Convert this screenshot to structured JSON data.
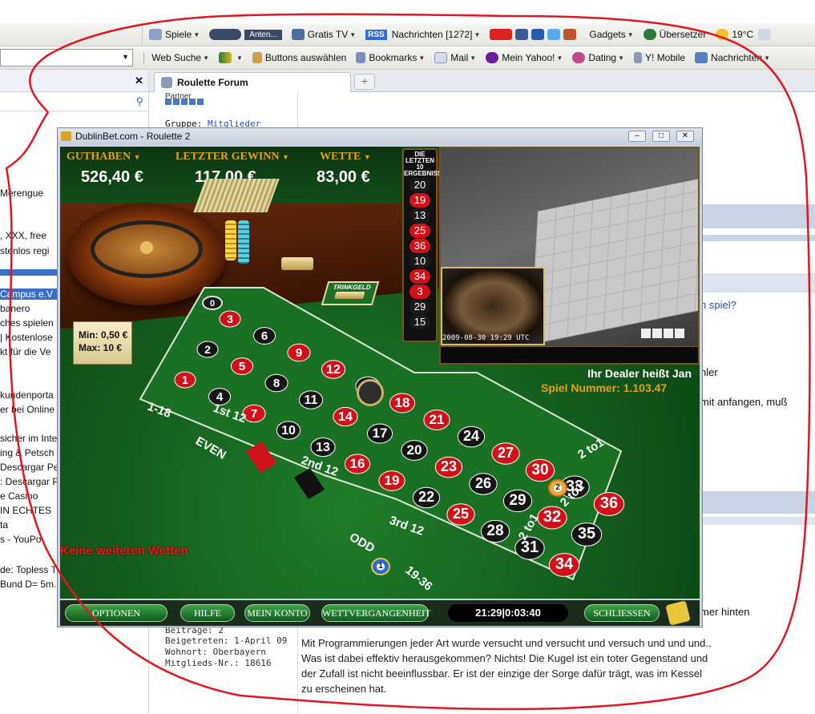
{
  "toolbar1": {
    "items": [
      "Spiele",
      "Anten...",
      "Gratis TV",
      "RSS",
      "Nachrichten [1272]",
      "Gadgets",
      "Übersetzer",
      "19°C"
    ]
  },
  "toolbar2": {
    "items": [
      "Web Suche",
      "Buttons auswählen",
      "Bookmarks",
      "Mail",
      "Mein Yahoo!",
      "Dating",
      "Y! Mobile",
      "Nachrichten"
    ]
  },
  "sidebar": {
    "items": [
      "Merengue",
      ", XXX, free",
      "stenlos regi",
      "Campus e.V",
      "banero",
      "ches spielen",
      "| Kostenlose",
      "kt für die Ve",
      "kundenporta",
      "er bei Online",
      "sicher im Inte",
      "ing & Petsch",
      "Descargar Pe",
      ": Descargar P",
      "e Casino",
      "IN ECHTES",
      "ta",
      "s - YouPo",
      "de: Topless Treats...",
      "Bund D= 5m..."
    ]
  },
  "tab": {
    "title": "Roulette Forum",
    "new_tab": "+"
  },
  "forum": {
    "partner_label": "Partner",
    "group_label": "Gruppe:",
    "group_value": "Mitglieder",
    "right_texts": [
      "n spiel?",
      "hler",
      "mit anfangen, muß",
      "mer hinten"
    ],
    "profile": [
      "Beiträge: 2",
      "Beigetreten: 1-April 09",
      "Wohnort: Oberbayern",
      "Mitglieds-Nr.: 18616"
    ],
    "post_lines": [
      "Mit Programmierungen jeder Art wurde versucht und versucht und versuch und und und..",
      "Was ist dabei effektiv herausgekommen? Nichts! Die Kugel ist ein toter Gegenstand und",
      "der Zufall ist nicht beeinflussbar. Er ist der einzige der Sorge dafür trägt, was im Kessel",
      "zu erscheinen hat."
    ]
  },
  "game": {
    "window_title": "DublinBet.com - Roulette 2",
    "balance_label": "GUTHABEN",
    "balance_value": "526,40 €",
    "lastwin_label": "LETZTER GEWINN",
    "lastwin_value": "117,00 €",
    "bet_label": "WETTE",
    "bet_value": "83,00 €",
    "results_header": "DIE LETZTEN 10 ERGEBNISSE",
    "results": [
      {
        "n": "20",
        "c": "black"
      },
      {
        "n": "19",
        "c": "red"
      },
      {
        "n": "13",
        "c": "black"
      },
      {
        "n": "25",
        "c": "red"
      },
      {
        "n": "36",
        "c": "red"
      },
      {
        "n": "10",
        "c": "black"
      },
      {
        "n": "34",
        "c": "red"
      },
      {
        "n": "3",
        "c": "red"
      },
      {
        "n": "29",
        "c": "black"
      },
      {
        "n": "15",
        "c": "black"
      }
    ],
    "video_timestamp": "2009-08-30 19:29 UTC",
    "dealer_text": "Ihr Dealer heißt Jan",
    "game_number": "Spiel Nummer: 1.103.47",
    "limits_min": "Min: 0,50 €",
    "limits_max": "Max: 10 €",
    "tip_label": "TRINKGELD",
    "no_more_bets": "Keine weiteren Wetten",
    "chip1": "1",
    "chip2": "2",
    "table": {
      "zero": "0",
      "rows": [
        [
          "3",
          "6",
          "9",
          "12",
          "15",
          "18",
          "21",
          "24",
          "27",
          "30",
          "33",
          "36"
        ],
        [
          "2",
          "5",
          "8",
          "11",
          "14",
          "17",
          "20",
          "23",
          "26",
          "29",
          "32",
          "35"
        ],
        [
          "1",
          "4",
          "7",
          "10",
          "13",
          "16",
          "19",
          "22",
          "25",
          "28",
          "31",
          "34"
        ]
      ],
      "red": [
        "1",
        "3",
        "5",
        "7",
        "9",
        "12",
        "14",
        "16",
        "18",
        "19",
        "21",
        "23",
        "25",
        "27",
        "30",
        "32",
        "34",
        "36"
      ],
      "dozens": [
        "1st 12",
        "2nd 12",
        "3rd 12"
      ],
      "columns": [
        "2 to1",
        "2 to1",
        "2 to1"
      ],
      "outside": [
        "1-18",
        "EVEN",
        "ODD",
        "19-36"
      ]
    },
    "buttons": [
      "OPTIONEN",
      "HILFE",
      "MEIN KONTO",
      "WETTVERGANGENHEIT",
      "SCHLIESSEN"
    ],
    "clock": "21:29|0:03:40"
  },
  "colors": {
    "felt": "#17691f",
    "gold": "#e0a31c",
    "red": "#d1111a",
    "annotation": "#e0171f"
  }
}
